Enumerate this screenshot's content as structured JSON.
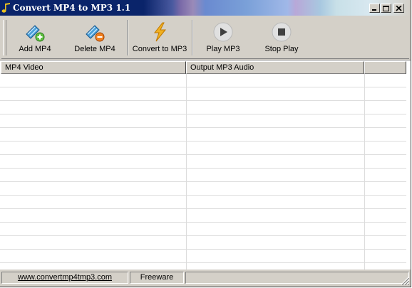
{
  "window": {
    "title": "Convert MP4 to MP3 1.1"
  },
  "toolbar": {
    "add_mp4": "Add MP4",
    "delete_mp4": "Delete MP4",
    "convert": "Convert to MP3",
    "play": "Play MP3",
    "stop": "Stop Play"
  },
  "list": {
    "columns": [
      "MP4 Video",
      "Output MP3 Audio",
      ""
    ],
    "rows": []
  },
  "statusbar": {
    "website": "www.convertmp4tmp3.com",
    "license": "Freeware",
    "message": ""
  },
  "icons": {
    "app": "music-note-icon",
    "add": "film-add-icon",
    "delete": "film-delete-icon",
    "convert": "lightning-icon",
    "play": "play-icon",
    "stop": "stop-icon"
  }
}
